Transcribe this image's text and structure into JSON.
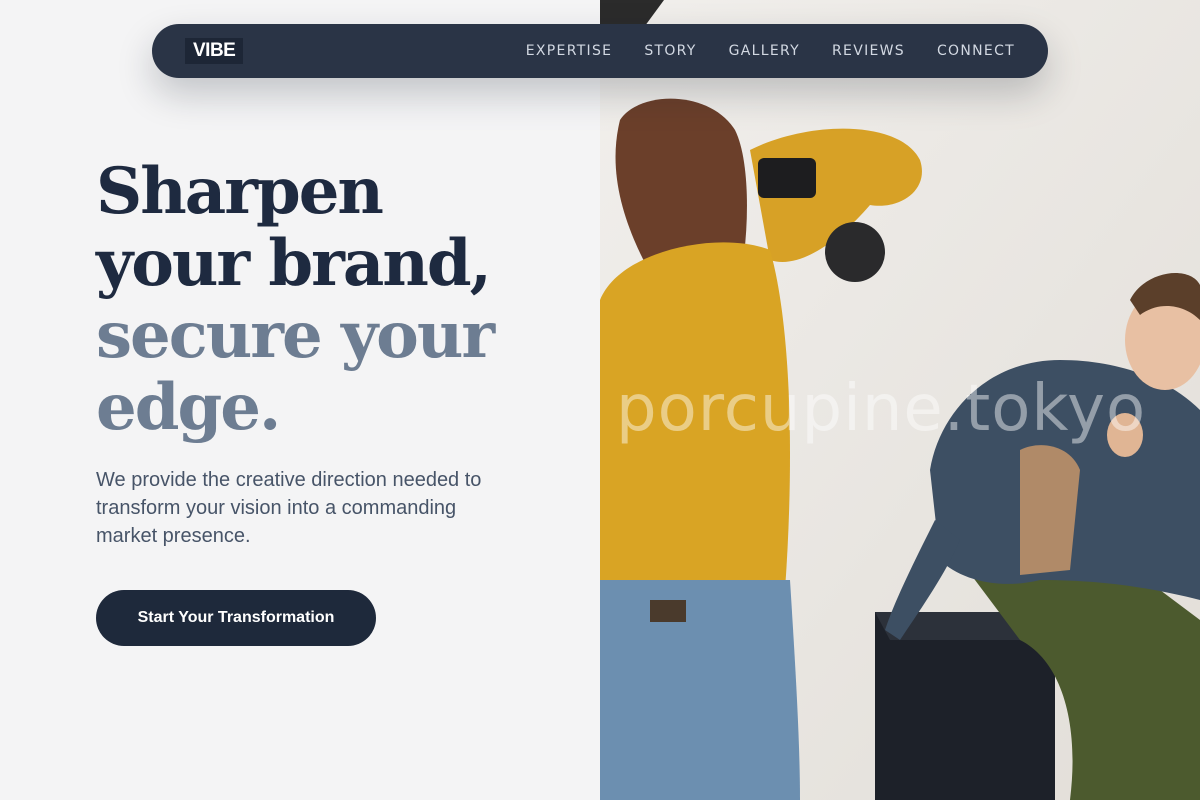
{
  "nav": {
    "logo": "VIBE",
    "links": [
      "EXPERTISE",
      "STORY",
      "GALLERY",
      "REVIEWS",
      "CONNECT"
    ]
  },
  "hero": {
    "headline_dark_1": "Sharpen",
    "headline_dark_2": "your brand,",
    "headline_muted_1": "secure your",
    "headline_muted_2": "edge.",
    "description": "We provide the creative direction needed to transform your vision into a commanding market presence.",
    "cta_label": "Start Your Transformation"
  },
  "image": {
    "watermark": "porcupine.tokyo"
  },
  "colors": {
    "navy": "#1e293b",
    "headline_dark": "#1e2a40",
    "headline_muted": "#6d7d92",
    "background": "#f4f4f5"
  }
}
